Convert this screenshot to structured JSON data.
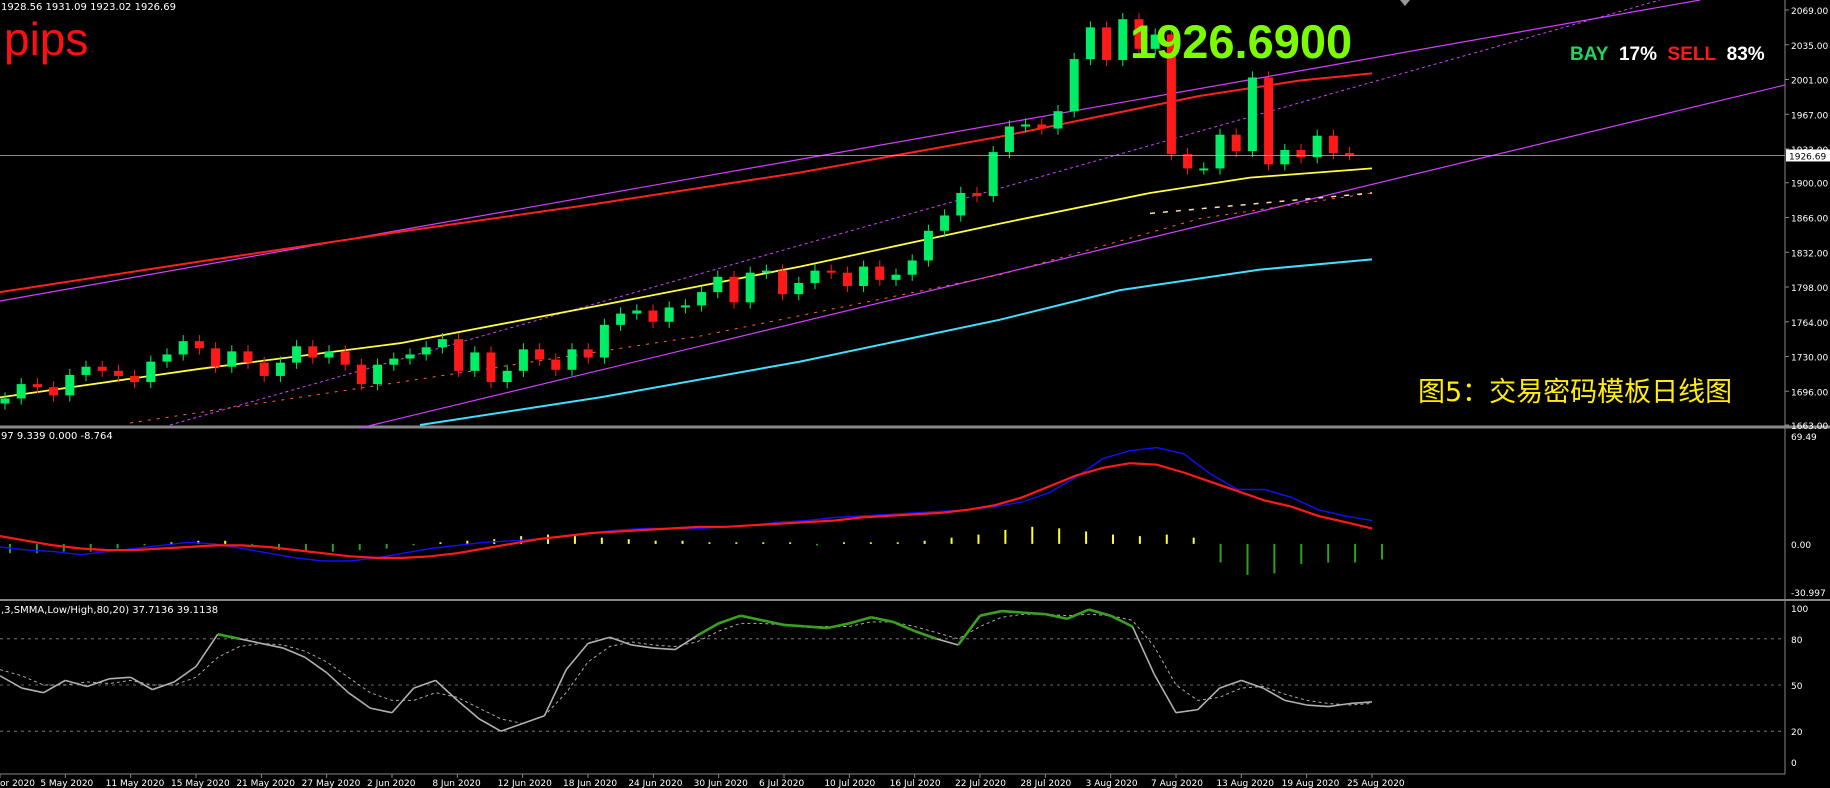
{
  "header": {
    "ohlc": "1928.56 1931.09 1923.02 1926.69",
    "pips_label": "pips",
    "current_price": "1926.6900",
    "sentiment": {
      "buy_label": "BAY",
      "buy_pct": "17%",
      "sell_label": "SELL",
      "sell_pct": "83%"
    },
    "caption": "图5：交易密码模板日线图",
    "price_marker": "1926.69"
  },
  "indicators": {
    "macd_header": "97 9.339 0.000 -8.764",
    "stoch_header": ",3,SMMA,Low/High,80,20) 37.7136 39.1138",
    "macd_axis": [
      "69.49",
      "0.00",
      "-30.997"
    ],
    "stoch_axis": [
      "100",
      "80",
      "50",
      "20",
      "0"
    ]
  },
  "colors": {
    "bull": "#00ee66",
    "bear": "#ff1a1a",
    "ma_red": "#ff2020",
    "ma_yellow": "#ffff40",
    "ma_cyan": "#40e0ff",
    "channel": "#d040ff",
    "macd_fast": "#1010ff",
    "macd_slow": "#ff1a1a",
    "stoch_main": "#b0b0b0",
    "stoch_hi": "#3aa020"
  },
  "chart_data": [
    {
      "type": "candlestick",
      "ylim": [
        1663.0,
        2069.0
      ],
      "y_ticks": [
        "2069.00",
        "2035.00",
        "2001.00",
        "1967.00",
        "1933.00",
        "1900.00",
        "1866.00",
        "1832.00",
        "1798.00",
        "1764.00",
        "1730.00",
        "1696.00",
        "1663.00"
      ],
      "x_tick_labels": [
        "or 2020",
        "5 May 2020",
        "11 May 2020",
        "15 May 2020",
        "21 May 2020",
        "27 May 2020",
        "2 Jun 2020",
        "8 Jun 2020",
        "12 Jun 2020",
        "18 Jun 2020",
        "24 Jun 2020",
        "30 Jun 2020",
        "6 Jul 2020",
        "10 Jul 2020",
        "16 Jul 2020",
        "22 Jul 2020",
        "28 Jul 2020",
        "3 Aug 2020",
        "7 Aug 2020",
        "13 Aug 2020",
        "19 Aug 2020",
        "25 Aug 2020"
      ],
      "close": [
        1689,
        1703,
        1700,
        1692,
        1712,
        1720,
        1716,
        1711,
        1705,
        1725,
        1732,
        1745,
        1738,
        1720,
        1735,
        1724,
        1711,
        1724,
        1740,
        1729,
        1735,
        1722,
        1703,
        1722,
        1728,
        1732,
        1739,
        1747,
        1716,
        1734,
        1705,
        1716,
        1737,
        1727,
        1717,
        1737,
        1729,
        1761,
        1772,
        1775,
        1764,
        1778,
        1780,
        1793,
        1808,
        1783,
        1812,
        1814,
        1791,
        1802,
        1814,
        1812,
        1799,
        1818,
        1805,
        1810,
        1824,
        1853,
        1868,
        1890,
        1887,
        1930,
        1955,
        1957,
        1953,
        1970,
        2021,
        2052,
        2020,
        2060,
        2031,
        2045,
        1928,
        1914,
        1914,
        1947,
        1931,
        2003,
        1918,
        1932,
        1925,
        1946,
        1929,
        1928
      ]
    },
    {
      "type": "line",
      "name": "MACD",
      "ylim": [
        -30.997,
        69.49
      ],
      "macd_line": [
        -2,
        -4,
        -5,
        -7,
        -5,
        -3,
        -1,
        1,
        0,
        -3,
        -6,
        -9,
        -11,
        -11,
        -9,
        -6,
        -3,
        -1,
        1,
        2,
        3,
        5,
        7,
        9,
        10,
        10,
        10,
        11,
        12,
        14,
        15,
        17,
        18,
        19,
        20,
        21,
        22,
        24,
        27,
        33,
        43,
        55,
        60,
        62,
        58,
        45,
        35,
        35,
        30,
        22,
        18,
        15
      ],
      "signal_line": [
        5,
        2,
        -1,
        -3,
        -4,
        -4,
        -3,
        -2,
        -1,
        -1,
        -2,
        -4,
        -6,
        -8,
        -9,
        -9,
        -8,
        -6,
        -3,
        0,
        3,
        5,
        7,
        8,
        9,
        10,
        11,
        11,
        12,
        13,
        14,
        15,
        17,
        18,
        19,
        20,
        22,
        25,
        30,
        37,
        44,
        49,
        52,
        51,
        46,
        40,
        34,
        28,
        24,
        18,
        14,
        10
      ],
      "histogram": [
        -6,
        -6,
        -5,
        -5,
        -3,
        -1,
        1,
        2,
        2,
        -2,
        -4,
        -5,
        -5,
        -4,
        -3,
        -1,
        1,
        2,
        3,
        5,
        6,
        5,
        4,
        3,
        2,
        2,
        1,
        1,
        1,
        1,
        -1,
        1,
        1,
        1,
        2,
        4,
        6,
        9,
        11,
        10,
        8,
        6,
        5,
        6,
        4,
        -12,
        -20,
        -19,
        -13,
        -12,
        -12,
        -10
      ]
    },
    {
      "type": "line",
      "name": "Stochastic",
      "ylim": [
        0,
        100
      ],
      "main": [
        56,
        48,
        45,
        53,
        49,
        54,
        55,
        47,
        52,
        62,
        83,
        80,
        77,
        74,
        68,
        58,
        45,
        35,
        32,
        48,
        53,
        40,
        28,
        20,
        25,
        30,
        60,
        77,
        81,
        76,
        74,
        73,
        82,
        90,
        95,
        92,
        89,
        88,
        87,
        90,
        94,
        91,
        85,
        80,
        76,
        95,
        98,
        97,
        96,
        93,
        99,
        95,
        88,
        57,
        32,
        34,
        48,
        53,
        48,
        40,
        37,
        36,
        38,
        39
      ],
      "signal": [
        60,
        56,
        50,
        50,
        52,
        51,
        53,
        50,
        50,
        55,
        68,
        75,
        77,
        76,
        72,
        65,
        55,
        45,
        40,
        40,
        45,
        42,
        35,
        28,
        25,
        30,
        45,
        65,
        75,
        78,
        76,
        75,
        78,
        85,
        90,
        90,
        89,
        88,
        88,
        88,
        91,
        91,
        88,
        84,
        80,
        88,
        94,
        96,
        96,
        95,
        96,
        95,
        92,
        75,
        50,
        40,
        42,
        48,
        49,
        44,
        40,
        38,
        37,
        38
      ]
    }
  ]
}
